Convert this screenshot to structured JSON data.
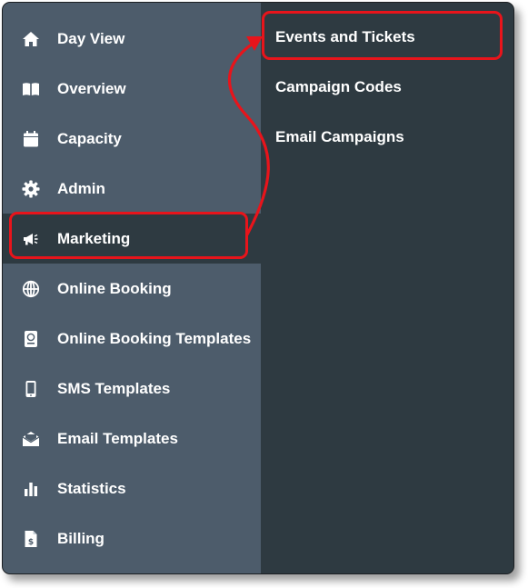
{
  "sidebar": {
    "items": [
      {
        "label": "Day View",
        "icon": "home-icon"
      },
      {
        "label": "Overview",
        "icon": "book-icon"
      },
      {
        "label": "Capacity",
        "icon": "calendar-icon"
      },
      {
        "label": "Admin",
        "icon": "gear-icon"
      },
      {
        "label": "Marketing",
        "icon": "megaphone-icon",
        "active": true
      },
      {
        "label": "Online Booking",
        "icon": "globe-icon"
      },
      {
        "label": "Online Booking Templates",
        "icon": "passport-icon"
      },
      {
        "label": "SMS Templates",
        "icon": "mobile-icon"
      },
      {
        "label": "Email Templates",
        "icon": "envelope-open-icon"
      },
      {
        "label": "Statistics",
        "icon": "bar-chart-icon"
      },
      {
        "label": "Billing",
        "icon": "invoice-icon"
      }
    ]
  },
  "submenu": {
    "items": [
      {
        "label": "Events and Tickets",
        "highlighted": true
      },
      {
        "label": "Campaign Codes"
      },
      {
        "label": "Email Campaigns"
      }
    ]
  },
  "colors": {
    "sidebar_bg": "#4d5c6b",
    "active_bg": "#2e3a41",
    "submenu_bg": "#2e3a41",
    "text": "#ffffff",
    "highlight": "#e8141b"
  }
}
